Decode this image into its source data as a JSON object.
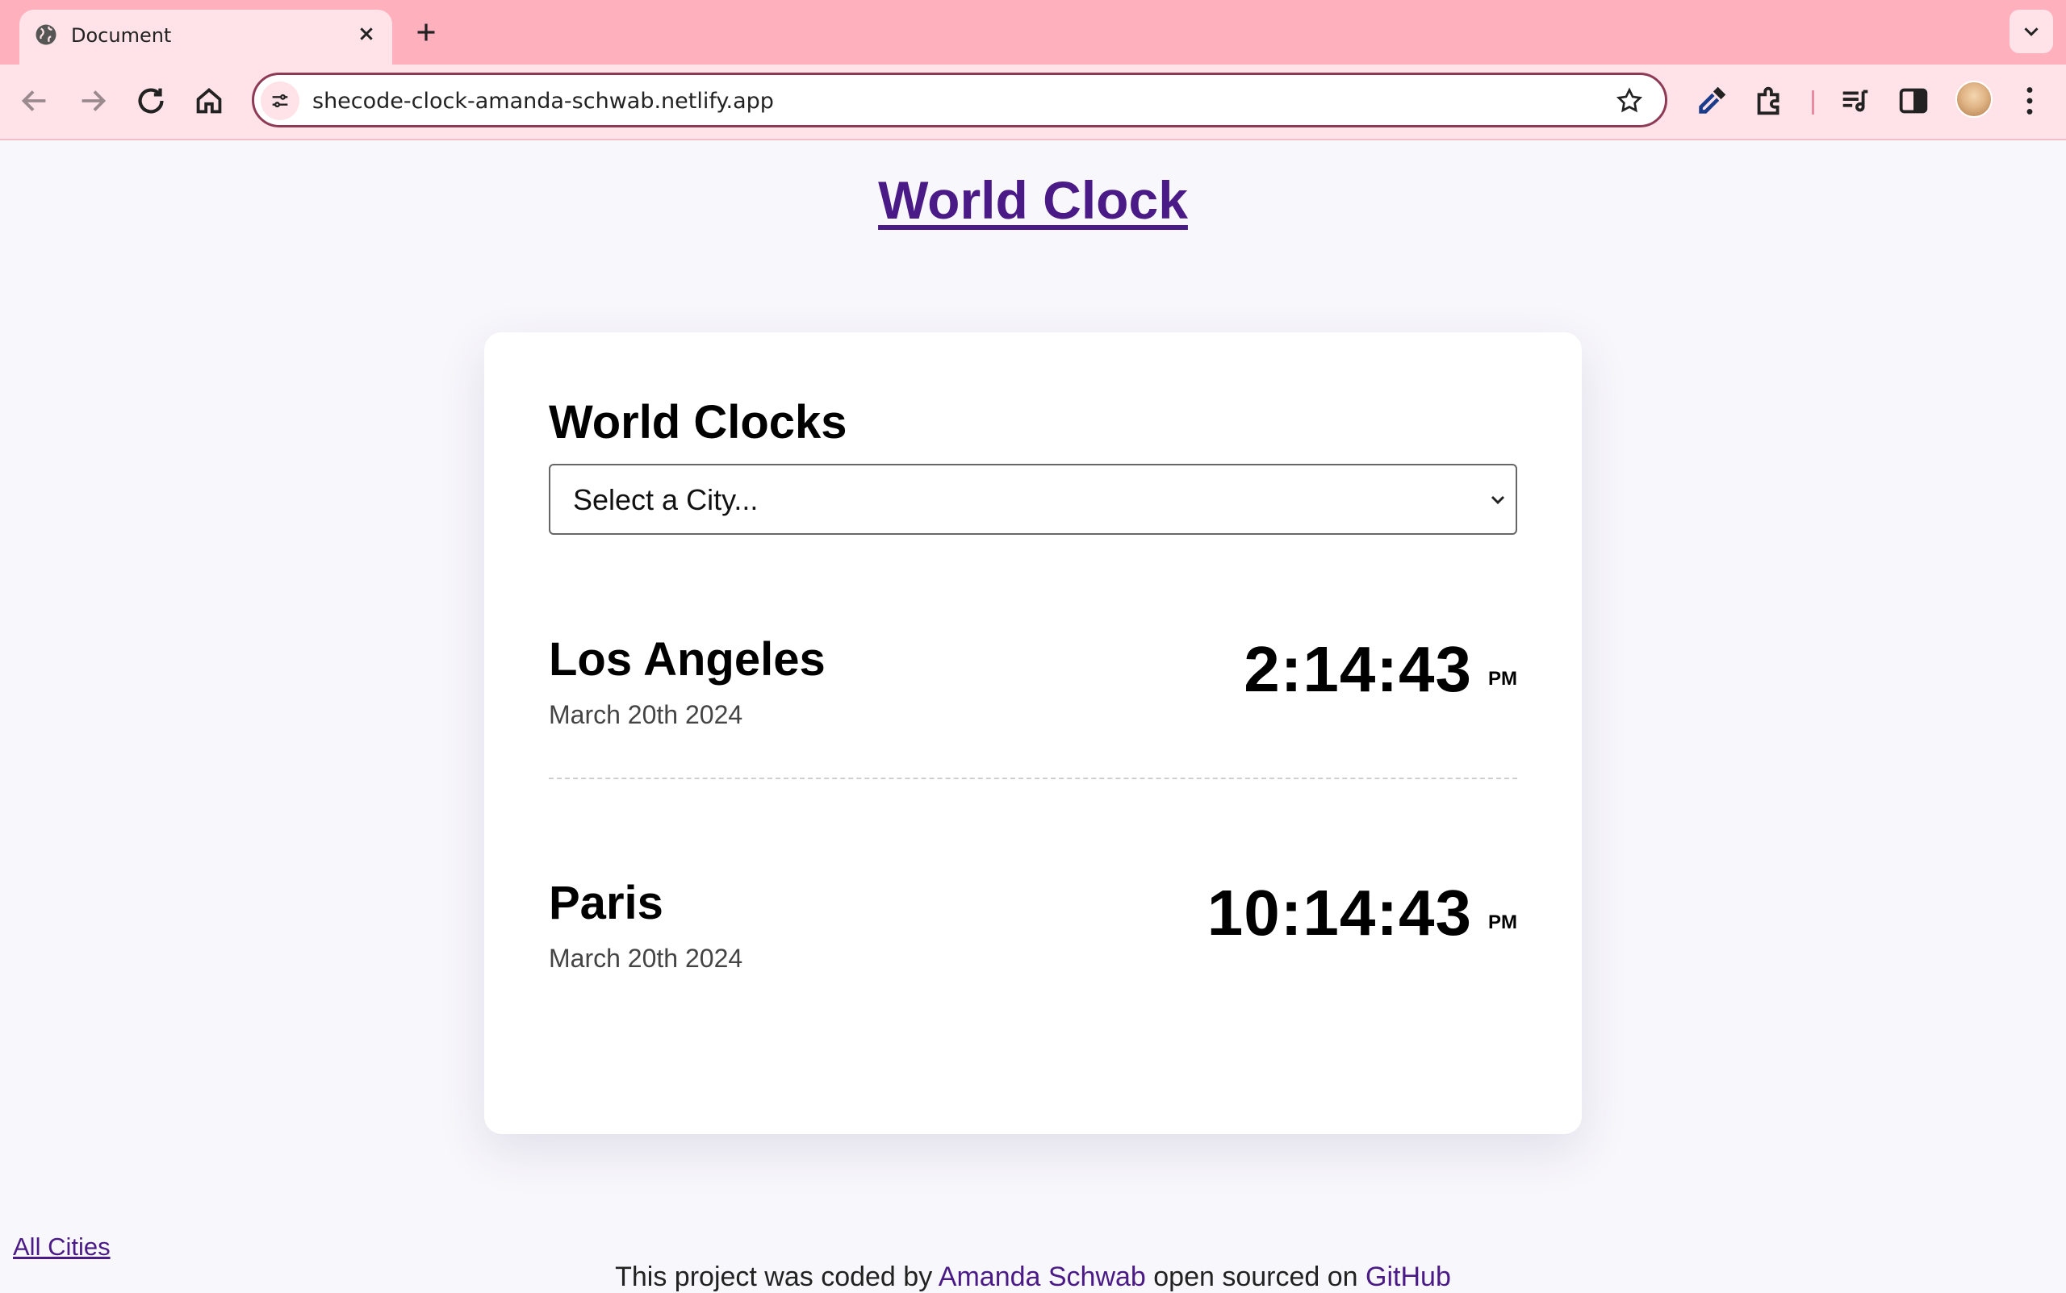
{
  "browser": {
    "tab_title": "Document",
    "url": "shecode-clock-amanda-schwab.netlify.app"
  },
  "page": {
    "title": "World Clock",
    "card_heading": "World Clocks",
    "select_placeholder": "Select a City...",
    "cities": [
      {
        "name": "Los Angeles",
        "date": "March 20th 2024",
        "time": "2:14:43",
        "ampm": "PM"
      },
      {
        "name": "Paris",
        "date": "March 20th 2024",
        "time": "10:14:43",
        "ampm": "PM"
      }
    ],
    "all_cities_link": "All Cities",
    "footer": {
      "prefix": "This project was coded by ",
      "author": "Amanda Schwab",
      "middle": " open sourced on ",
      "repo": "GitHub"
    }
  },
  "colors": {
    "tabstrip": "#ffb0bd",
    "toolbar": "#ffe3e8",
    "link": "#4a1a86",
    "page_bg": "#f8f7fc"
  },
  "icons": [
    "globe-icon",
    "close-icon",
    "plus-icon",
    "chevron-down-icon",
    "back-arrow-icon",
    "forward-arrow-icon",
    "reload-icon",
    "home-icon",
    "site-settings-icon",
    "star-icon",
    "eyedropper-icon",
    "extensions-icon",
    "media-playlist-icon",
    "side-panel-icon",
    "more-vert-icon"
  ]
}
